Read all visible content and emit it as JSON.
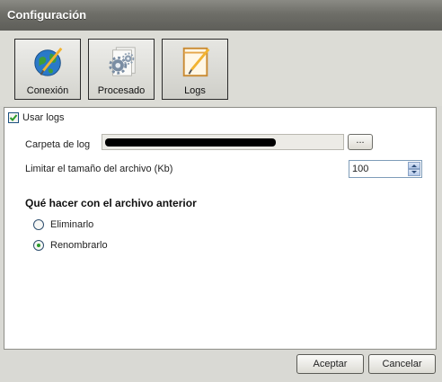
{
  "window": {
    "title": "Configuración"
  },
  "toolbar": {
    "buttons": [
      {
        "label": "Conexión",
        "icon": "globe-icon"
      },
      {
        "label": "Procesado",
        "icon": "gears-icon"
      },
      {
        "label": "Logs",
        "icon": "notepad-icon"
      }
    ],
    "selected": "Logs"
  },
  "logs": {
    "use_logs_label": "Usar logs",
    "use_logs_checked": true,
    "folder_label": "Carpeta de log",
    "folder_value_redacted": true,
    "browse_label": "...",
    "limit_label": "Limitar el tamaño del archivo (Kb)",
    "limit_value": "100",
    "section_title": "Qué hacer con el archivo anterior",
    "options": [
      {
        "label": "Eliminarlo",
        "selected": false
      },
      {
        "label": "Renombrarlo",
        "selected": true
      }
    ]
  },
  "footer": {
    "accept_label": "Aceptar",
    "cancel_label": "Cancelar"
  },
  "colors": {
    "titlebar": "#6e6e68",
    "check_mark": "#2a9b2a",
    "radio_dot": "#2a9b2a"
  }
}
